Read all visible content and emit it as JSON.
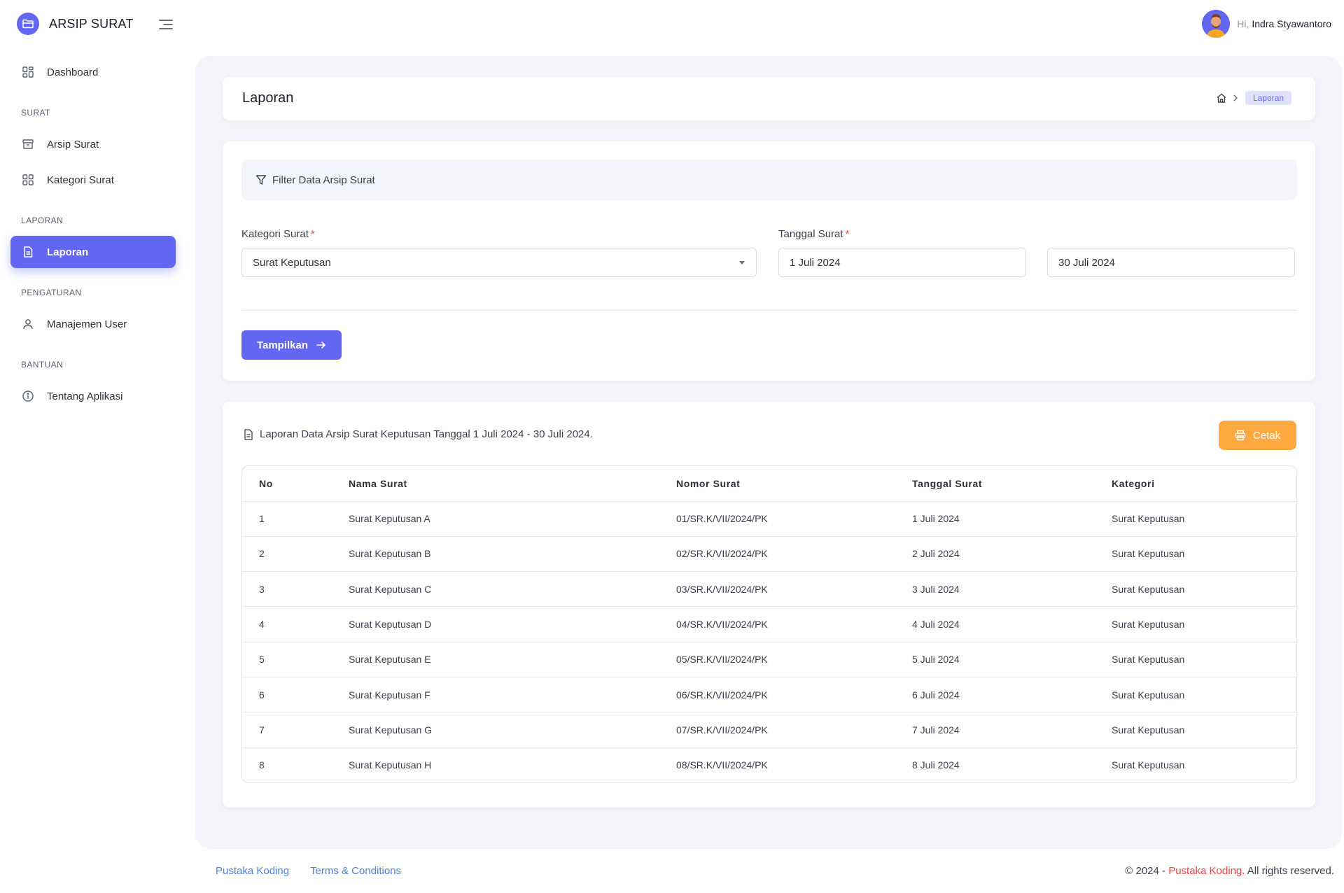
{
  "app": {
    "title": "ARSIP SURAT"
  },
  "user": {
    "greeting": "Hi,",
    "name": "Indra Styawantoro"
  },
  "sidebar": {
    "dashboard": "Dashboard",
    "section_surat": "SURAT",
    "arsip_surat": "Arsip Surat",
    "kategori_surat": "Kategori Surat",
    "section_laporan": "LAPORAN",
    "laporan": "Laporan",
    "section_pengaturan": "PENGATURAN",
    "manajemen_user": "Manajemen User",
    "section_bantuan": "BANTUAN",
    "tentang_aplikasi": "Tentang Aplikasi"
  },
  "page": {
    "title": "Laporan",
    "breadcrumb_current": "Laporan"
  },
  "filter": {
    "heading": "Filter Data Arsip Surat",
    "kategori_label": "Kategori Surat",
    "kategori_value": "Surat Keputusan",
    "tanggal_label": "Tanggal Surat",
    "tanggal_start": "1 Juli 2024",
    "tanggal_end": "30 Juli 2024",
    "required_mark": "*",
    "submit_label": "Tampilkan"
  },
  "report": {
    "title": "Laporan Data Arsip Surat Keputusan Tanggal 1 Juli 2024 - 30 Juli 2024.",
    "print_label": "Cetak",
    "columns": [
      "No",
      "Nama Surat",
      "Nomor Surat",
      "Tanggal Surat",
      "Kategori"
    ],
    "rows": [
      [
        "1",
        "Surat Keputusan A",
        "01/SR.K/VII/2024/PK",
        "1 Juli 2024",
        "Surat Keputusan"
      ],
      [
        "2",
        "Surat Keputusan B",
        "02/SR.K/VII/2024/PK",
        "2 Juli 2024",
        "Surat Keputusan"
      ],
      [
        "3",
        "Surat Keputusan C",
        "03/SR.K/VII/2024/PK",
        "3 Juli 2024",
        "Surat Keputusan"
      ],
      [
        "4",
        "Surat Keputusan D",
        "04/SR.K/VII/2024/PK",
        "4 Juli 2024",
        "Surat Keputusan"
      ],
      [
        "5",
        "Surat Keputusan E",
        "05/SR.K/VII/2024/PK",
        "5 Juli 2024",
        "Surat Keputusan"
      ],
      [
        "6",
        "Surat Keputusan F",
        "06/SR.K/VII/2024/PK",
        "6 Juli 2024",
        "Surat Keputusan"
      ],
      [
        "7",
        "Surat Keputusan G",
        "07/SR.K/VII/2024/PK",
        "7 Juli 2024",
        "Surat Keputusan"
      ],
      [
        "8",
        "Surat Keputusan H",
        "08/SR.K/VII/2024/PK",
        "8 Juli 2024",
        "Surat Keputusan"
      ]
    ]
  },
  "footer": {
    "link1": "Pustaka Koding",
    "link2": "Terms & Conditions",
    "copy_prefix": "© 2024 - ",
    "copy_brand": "Pustaka Koding.",
    "copy_suffix": " All rights reserved."
  },
  "colors": {
    "accent": "#6366f1",
    "print": "#ffa940",
    "required": "#ef4444",
    "link": "#4f7fd9"
  }
}
